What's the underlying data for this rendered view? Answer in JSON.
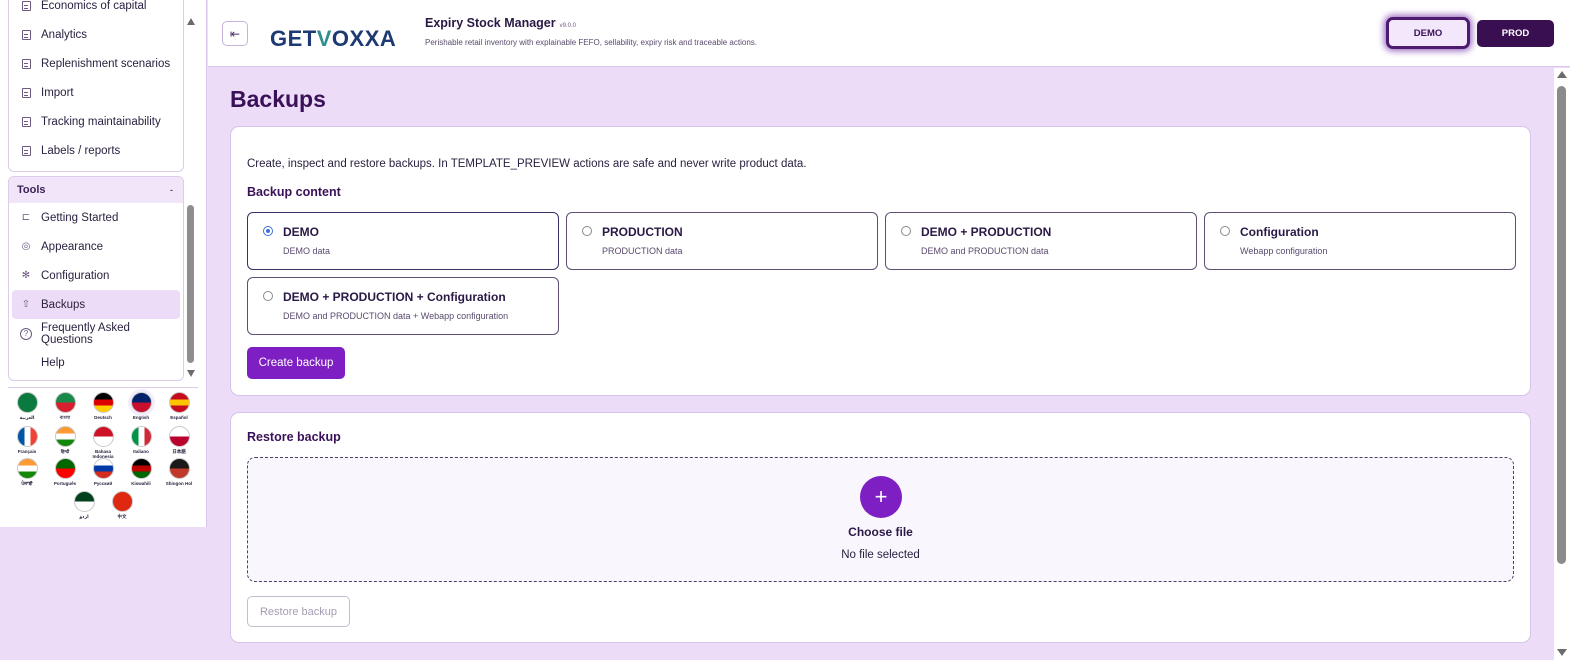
{
  "sidebar": {
    "top_items": [
      {
        "label": "Economics of capital",
        "icon": "document-icon"
      },
      {
        "label": "Analytics",
        "icon": "document-icon"
      },
      {
        "label": "Replenishment scenarios",
        "icon": "document-icon"
      },
      {
        "label": "Import",
        "icon": "document-icon"
      },
      {
        "label": "Tracking maintainability",
        "icon": "document-icon"
      },
      {
        "label": "Labels / reports",
        "icon": "document-icon"
      }
    ],
    "tools_title": "Tools",
    "tools_caret": "-",
    "tools_items": [
      {
        "label": "Getting Started",
        "glyph": "⊏"
      },
      {
        "label": "Appearance",
        "glyph": "◎"
      },
      {
        "label": "Configuration",
        "glyph": "✻"
      },
      {
        "label": "Backups",
        "glyph": "⇧"
      },
      {
        "label": "Frequently Asked Questions",
        "glyph": "?"
      },
      {
        "label": "Help",
        "glyph": ""
      }
    ],
    "languages": [
      {
        "label": "العربية",
        "colors": [
          "#0b7a3e",
          "#0b7a3e"
        ]
      },
      {
        "label": "বাংলা",
        "colors": [
          "#1a8a4a",
          "#d6202f"
        ]
      },
      {
        "label": "Deutsch",
        "colors": [
          "#000000",
          "#dd0000",
          "#ffce00"
        ]
      },
      {
        "label": "English",
        "colors": [
          "#012169",
          "#c8102e"
        ]
      },
      {
        "label": "Español",
        "colors": [
          "#c60b1e",
          "#ffc400",
          "#c60b1e"
        ]
      },
      {
        "label": "Français",
        "colors": [
          "#0055a4",
          "#ffffff",
          "#ef4135"
        ]
      },
      {
        "label": "हिन्दी",
        "colors": [
          "#ff9933",
          "#ffffff",
          "#138808"
        ]
      },
      {
        "label": "Bahasa Indonesia",
        "colors": [
          "#ce1126",
          "#ffffff"
        ]
      },
      {
        "label": "Italiano",
        "colors": [
          "#009246",
          "#ffffff",
          "#ce2b37"
        ]
      },
      {
        "label": "日本語",
        "colors": [
          "#ffffff",
          "#bc002d"
        ]
      },
      {
        "label": "ਪੰਜਾਬੀ",
        "colors": [
          "#ff9933",
          "#ffffff",
          "#138808"
        ]
      },
      {
        "label": "Português",
        "colors": [
          "#006600",
          "#ff0000"
        ]
      },
      {
        "label": "Русский",
        "colors": [
          "#ffffff",
          "#0039a6",
          "#d52b1e"
        ]
      },
      {
        "label": "Kiswahili",
        "colors": [
          "#000000",
          "#bb0000",
          "#006600"
        ]
      },
      {
        "label": "Shingon Hol",
        "colors": [
          "#1a1a1a",
          "#c0392b"
        ]
      },
      {
        "label": "اردو",
        "colors": [
          "#01411c",
          "#ffffff"
        ]
      },
      {
        "label": "中文",
        "colors": [
          "#de2910",
          "#de2910"
        ]
      }
    ]
  },
  "header": {
    "logo_left": "GET",
    "logo_v": "V",
    "logo_right": "OXXA",
    "app_title": "Expiry Stock Manager",
    "version": "v9.0.0",
    "subtitle": "Perishable retail inventory with explainable FEFO, sellability, expiry risk and traceable actions.",
    "env_demo": "DEMO",
    "env_prod": "PROD"
  },
  "main": {
    "page_title": "Backups",
    "description": "Create, inspect and restore backups. In TEMPLATE_PREVIEW actions are safe and never write product data.",
    "backup_content_title": "Backup content",
    "options": [
      {
        "title": "DEMO",
        "sub": "DEMO data",
        "selected": true
      },
      {
        "title": "PRODUCTION",
        "sub": "PRODUCTION data",
        "selected": false
      },
      {
        "title": "DEMO + PRODUCTION",
        "sub": "DEMO and PRODUCTION data",
        "selected": false
      },
      {
        "title": "Configuration",
        "sub": "Webapp configuration",
        "selected": false
      },
      {
        "title": "DEMO + PRODUCTION + Configuration",
        "sub": "DEMO and PRODUCTION data + Webapp configuration",
        "selected": false
      }
    ],
    "create_button": "Create backup",
    "restore_title": "Restore backup",
    "plus_glyph": "+",
    "choose_file": "Choose file",
    "no_file": "No file selected",
    "restore_button": "Restore backup"
  },
  "colors": {
    "accent": "#7d1fc2",
    "brand_dark": "#3a0f52",
    "page_bg": "#ecdcf7"
  }
}
